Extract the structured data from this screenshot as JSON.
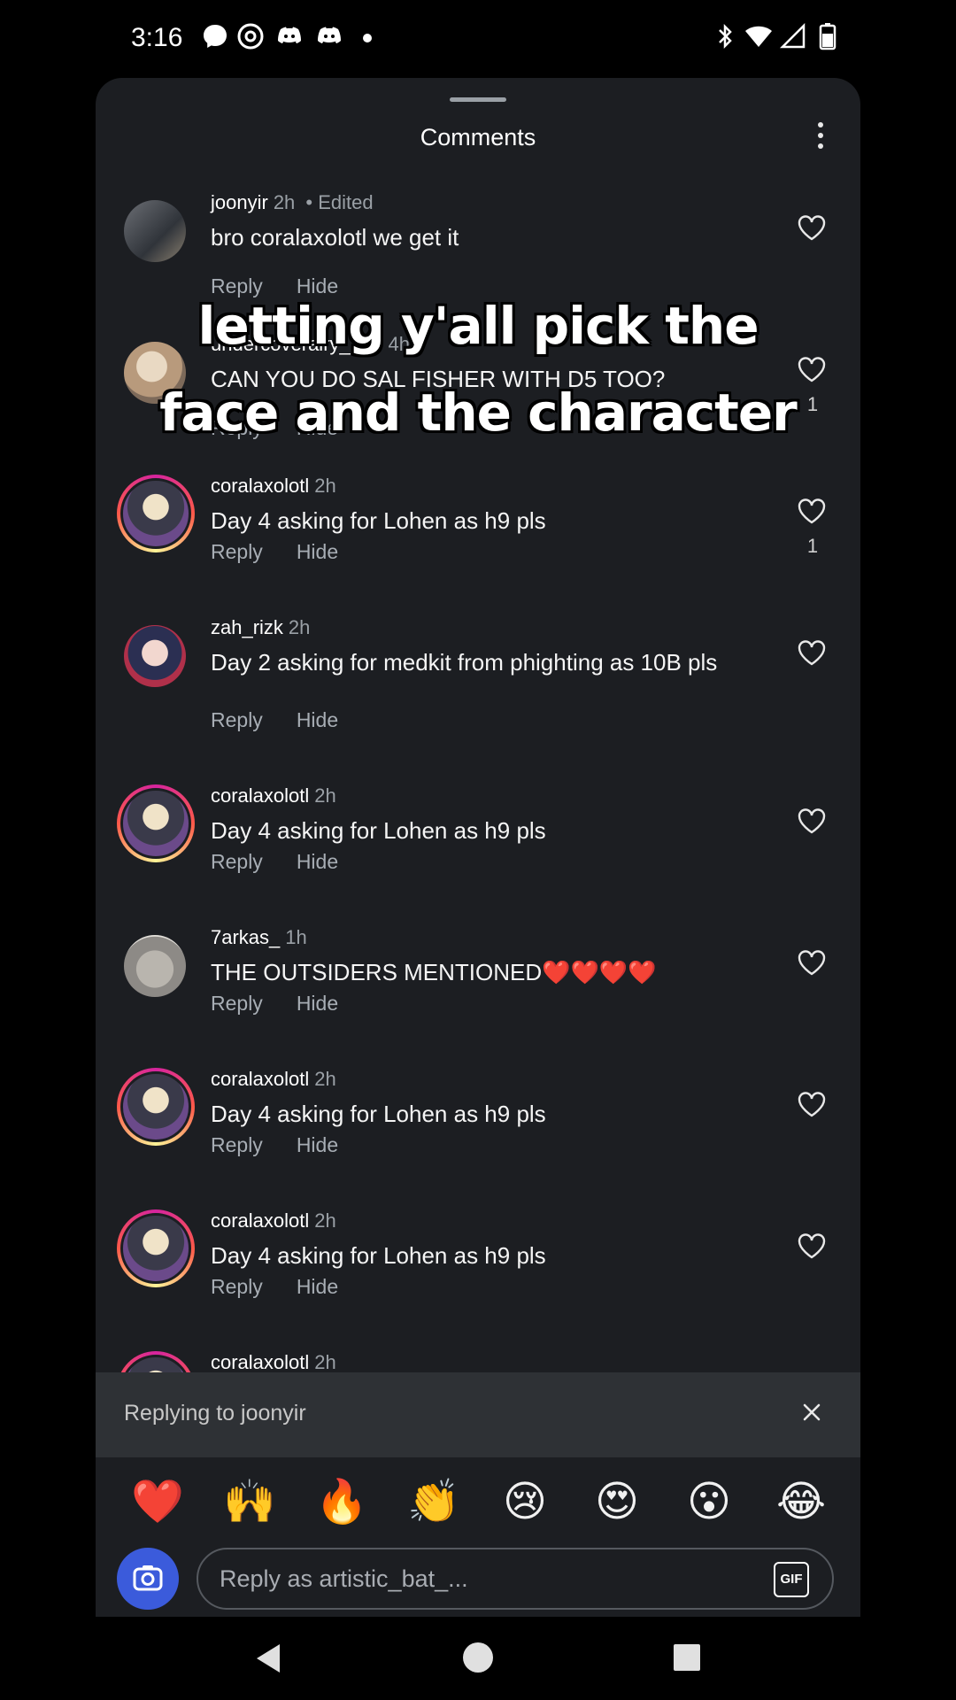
{
  "status_bar": {
    "time": "3:16"
  },
  "sheet": {
    "title": "Comments"
  },
  "comments": [
    {
      "user": "joonyir",
      "time": "2h",
      "edited": "• Edited",
      "text": "bro coralaxolotl we get it",
      "reply": "Reply",
      "hide": "Hide",
      "likes": ""
    },
    {
      "user": "undercoverairy_2_0",
      "time": "4h",
      "edited": "",
      "text": "CAN YOU DO SAL FISHER WITH D5 TOO?",
      "reply": "Reply",
      "hide": "Hide",
      "likes": "1"
    },
    {
      "user": "coralaxolotl",
      "time": "2h",
      "edited": "",
      "text": "Day 4 asking for Lohen as h9 pls",
      "reply": "Reply",
      "hide": "Hide",
      "likes": "1"
    },
    {
      "user": "zah_rizk",
      "time": "2h",
      "edited": "",
      "text": "Day 2 asking for medkit from phighting as 10B pls",
      "reply": "Reply",
      "hide": "Hide",
      "likes": ""
    },
    {
      "user": "coralaxolotl",
      "time": "2h",
      "edited": "",
      "text": "Day 4 asking for Lohen as h9 pls",
      "reply": "Reply",
      "hide": "Hide",
      "likes": ""
    },
    {
      "user": "7arkas_",
      "time": "1h",
      "edited": "",
      "text": "THE OUTSIDERS MENTIONED❤️❤️❤️❤️",
      "reply": "Reply",
      "hide": "Hide",
      "likes": ""
    },
    {
      "user": "coralaxolotl",
      "time": "2h",
      "edited": "",
      "text": "Day 4 asking for Lohen as h9 pls",
      "reply": "Reply",
      "hide": "Hide",
      "likes": ""
    },
    {
      "user": "coralaxolotl",
      "time": "2h",
      "edited": "",
      "text": "Day 4 asking for Lohen as h9 pls",
      "reply": "Reply",
      "hide": "Hide",
      "likes": ""
    },
    {
      "user": "coralaxolotl",
      "time": "2h",
      "edited": "",
      "text": "",
      "reply": "",
      "hide": "",
      "likes": ""
    }
  ],
  "overlay_caption": {
    "line1": "letting y'all pick the",
    "line2": "face and the character"
  },
  "replying": {
    "label": "Replying to joonyir"
  },
  "emojis": [
    "❤️",
    "🙌",
    "🔥",
    "👏",
    "😢",
    "😍",
    "😮",
    "😂"
  ],
  "composer": {
    "placeholder": "Reply as artistic_bat_...",
    "gif_label": "GIF"
  },
  "colors": {
    "sheet_bg": "#1c1e22",
    "reply_bar_bg": "#2e3135",
    "camera_button": "#3b5bdb"
  }
}
